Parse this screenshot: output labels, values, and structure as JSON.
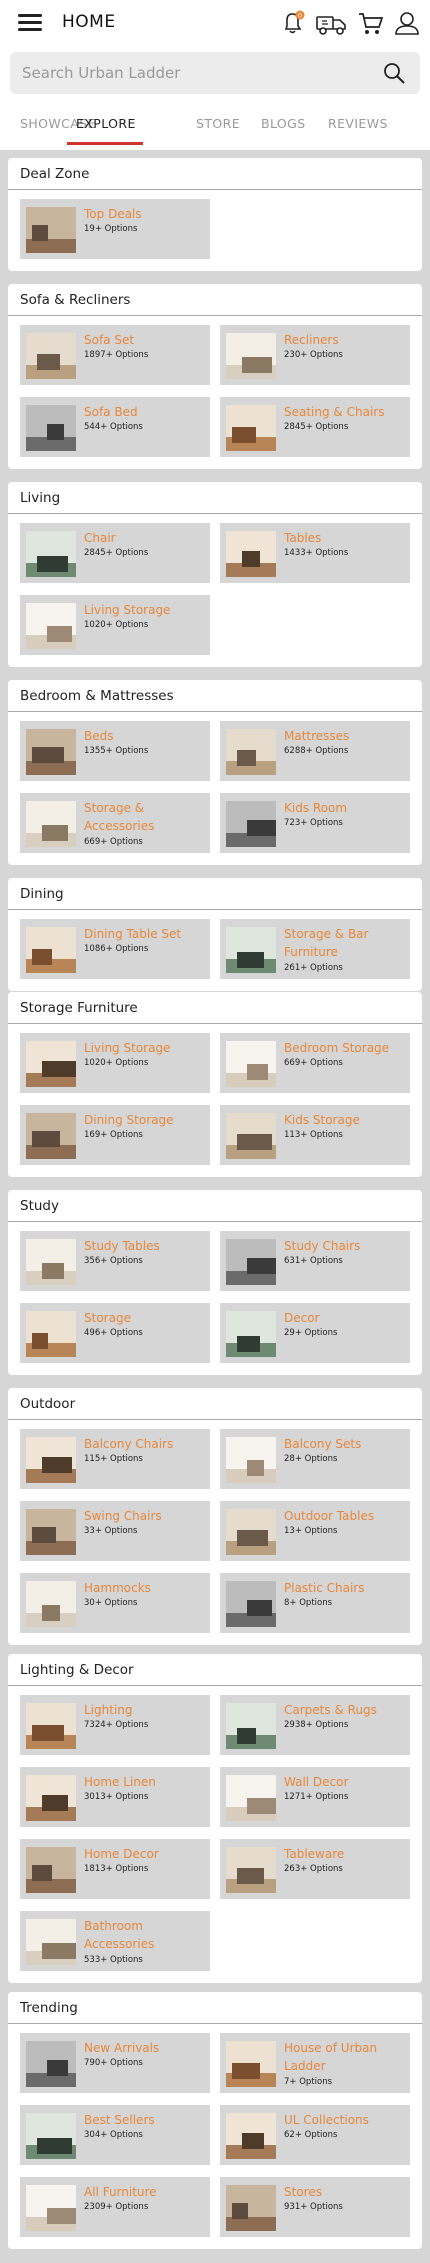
{
  "header": {
    "title": "HOME",
    "icons": [
      "menu-icon",
      "bell-icon",
      "delivery-truck-icon",
      "cart-icon",
      "user-icon"
    ],
    "notification_badge": "0"
  },
  "search": {
    "placeholder": "Search Urban Ladder"
  },
  "tabs": [
    "SHOWCASE",
    "EXPLORE",
    "STORE",
    "BLOGS",
    "REVIEWS"
  ],
  "active_tab": "EXPLORE",
  "colors": {
    "accent": "#e8873a",
    "tab_underline": "#d0342c",
    "card_bg": "#d6d6d6"
  },
  "sections": [
    {
      "title": "Deal Zone",
      "items": [
        {
          "name": "Top Deals",
          "count": "19+ Options"
        }
      ]
    },
    {
      "title": "Sofa & Recliners",
      "items": [
        {
          "name": "Sofa Set",
          "count": "1897+ Options"
        },
        {
          "name": "Recliners",
          "count": "230+ Options"
        },
        {
          "name": "Sofa Bed",
          "count": "544+ Options"
        },
        {
          "name": "Seating & Chairs",
          "count": "2845+ Options"
        }
      ]
    },
    {
      "title": "Living",
      "items": [
        {
          "name": "Chair",
          "count": "2845+ Options"
        },
        {
          "name": "Tables",
          "count": "1433+ Options"
        },
        {
          "name": "Living Storage",
          "count": "1020+ Options"
        }
      ]
    },
    {
      "title": "Bedroom & Mattresses",
      "items": [
        {
          "name": "Beds",
          "count": "1355+ Options"
        },
        {
          "name": "Mattresses",
          "count": "6288+ Options"
        },
        {
          "name": "Storage & Accessories",
          "count": "669+ Options"
        },
        {
          "name": "Kids Room",
          "count": "723+ Options"
        }
      ]
    },
    {
      "title": "Dining",
      "items": [
        {
          "name": "Dining Table Set",
          "count": "1086+ Options"
        },
        {
          "name": "Storage & Bar Furniture",
          "count": "261+ Options"
        }
      ]
    },
    {
      "title": "Storage Furniture",
      "items": [
        {
          "name": "Living Storage",
          "count": "1020+ Options"
        },
        {
          "name": "Bedroom Storage",
          "count": "669+ Options"
        },
        {
          "name": "Dining Storage",
          "count": "169+ Options"
        },
        {
          "name": "Kids Storage",
          "count": "113+ Options"
        }
      ]
    },
    {
      "title": "Study",
      "items": [
        {
          "name": "Study Tables",
          "count": "356+ Options"
        },
        {
          "name": "Study Chairs",
          "count": "631+ Options"
        },
        {
          "name": "Storage",
          "count": "496+ Options"
        },
        {
          "name": "Decor",
          "count": "29+ Options"
        }
      ]
    },
    {
      "title": "Outdoor",
      "items": [
        {
          "name": "Balcony Chairs",
          "count": "115+ Options"
        },
        {
          "name": "Balcony Sets",
          "count": "28+ Options"
        },
        {
          "name": "Swing Chairs",
          "count": "33+ Options"
        },
        {
          "name": "Outdoor Tables",
          "count": "13+ Options"
        },
        {
          "name": "Hammocks",
          "count": "30+ Options"
        },
        {
          "name": "Plastic Chairs",
          "count": "8+ Options"
        }
      ]
    },
    {
      "title": "Lighting & Decor",
      "items": [
        {
          "name": "Lighting",
          "count": "7324+ Options"
        },
        {
          "name": "Carpets & Rugs",
          "count": "2938+ Options"
        },
        {
          "name": "Home Linen",
          "count": "3013+ Options"
        },
        {
          "name": "Wall Decor",
          "count": "1271+ Options"
        },
        {
          "name": "Home Decor",
          "count": "1813+ Options"
        },
        {
          "name": "Tableware",
          "count": "263+ Options"
        },
        {
          "name": "Bathroom Accessories",
          "count": "533+ Options"
        }
      ]
    },
    {
      "title": "Trending",
      "items": [
        {
          "name": "New Arrivals",
          "count": "790+ Options"
        },
        {
          "name": "House of Urban Ladder",
          "count": "7+ Options"
        },
        {
          "name": "Best Sellers",
          "count": "304+ Options"
        },
        {
          "name": "UL Collections",
          "count": "62+ Options"
        },
        {
          "name": "All Furniture",
          "count": "2309+ Options"
        },
        {
          "name": "Stores",
          "count": "931+ Options"
        }
      ]
    }
  ]
}
